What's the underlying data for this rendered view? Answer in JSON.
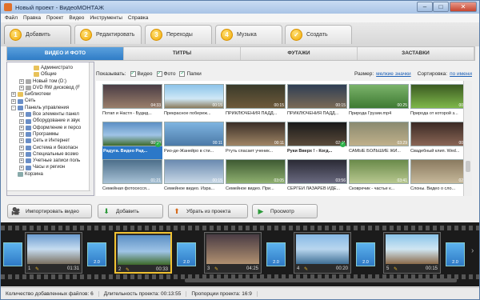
{
  "window": {
    "title": "Новый проект - ВидеоМОНТАЖ"
  },
  "menu": [
    "Файл",
    "Правка",
    "Проект",
    "Видео",
    "Инструменты",
    "Справка"
  ],
  "steps": [
    {
      "num": "1",
      "label": "Добавить",
      "active": true
    },
    {
      "num": "2",
      "label": "Редактировать"
    },
    {
      "num": "3",
      "label": "Переходы"
    },
    {
      "num": "4",
      "label": "Музыка"
    },
    {
      "num": "✓",
      "label": "Создать"
    }
  ],
  "subtabs": [
    "ВИДЕО И ФОТО",
    "ТИТРЫ",
    "ФУТАЖИ",
    "ЗАСТАВКИ"
  ],
  "tree": [
    {
      "label": "Администрато",
      "indent": 5,
      "exp": "",
      "color": "#e8c25a"
    },
    {
      "label": "Общие",
      "indent": 5,
      "exp": "",
      "color": "#e8c25a"
    },
    {
      "label": "Новый том (D:)",
      "indent": 3,
      "exp": "+",
      "color": "#aaa"
    },
    {
      "label": "DVD RW дисковод (F",
      "indent": 3,
      "exp": "+",
      "color": "#aaa"
    },
    {
      "label": "Библиотеки",
      "indent": 1,
      "exp": "+",
      "color": "#e8c25a"
    },
    {
      "label": "Сеть",
      "indent": 1,
      "exp": "+",
      "color": "#6b8fc7"
    },
    {
      "label": "Панель управления",
      "indent": 1,
      "exp": "-",
      "color": "#6b8fc7"
    },
    {
      "label": "Все элементы панел",
      "indent": 3,
      "exp": "+",
      "color": "#6b8fc7"
    },
    {
      "label": "Оборудование и звук",
      "indent": 3,
      "exp": "+",
      "color": "#6b8fc7"
    },
    {
      "label": "Оформление и персо",
      "indent": 3,
      "exp": "+",
      "color": "#6b8fc7"
    },
    {
      "label": "Программы",
      "indent": 3,
      "exp": "+",
      "color": "#6b8fc7"
    },
    {
      "label": "Сеть и Интернет",
      "indent": 3,
      "exp": "+",
      "color": "#6b8fc7"
    },
    {
      "label": "Система и безопасн",
      "indent": 3,
      "exp": "+",
      "color": "#6b8fc7"
    },
    {
      "label": "Специальные возмо",
      "indent": 3,
      "exp": "+",
      "color": "#6b8fc7"
    },
    {
      "label": "Учетные записи поль",
      "indent": 3,
      "exp": "+",
      "color": "#6b8fc7"
    },
    {
      "label": "Часы и регион",
      "indent": 3,
      "exp": "+",
      "color": "#6b8fc7"
    },
    {
      "label": "Корзина",
      "indent": 1,
      "exp": "",
      "color": "#8aa"
    }
  ],
  "filter": {
    "show_label": "Показывать:",
    "video": "Видео",
    "photo": "Фото",
    "folders": "Папки",
    "size_label": "Размер:",
    "size_value": "мелкие значки",
    "sort_label": "Сортировка:",
    "sort_value": "по имени"
  },
  "files": [
    {
      "cap": "Потап и Настя - Будид...",
      "dur": "04:33",
      "bg": "linear-gradient(#4a3c44,#9a7f6b)"
    },
    {
      "cap": "Прекрасное побереж...",
      "dur": "00:15",
      "bg": "linear-gradient(#8cc4ea,#cfe8f6 60%,#8a7a5a)"
    },
    {
      "cap": "ПРИКЛЮЧЕНИЯ ПАДД...",
      "dur": "00:15",
      "bg": "linear-gradient(#3a3a2a,#6e5a3a)"
    },
    {
      "cap": "ПРИКЛЮЧЕНИЯ ПАДД...",
      "dur": "00:15",
      "bg": "linear-gradient(#2f3e55,#7a6a55)"
    },
    {
      "cap": "Природа Грузии.mp4",
      "dur": "00:25",
      "bg": "linear-gradient(#7ab36a,#3f7a33)"
    },
    {
      "cap": "Природа от которой з...",
      "dur": "00:23",
      "bg": "linear-gradient(#3b5a22,#7fb84a)"
    },
    {
      "cap": "Радуга. Видео Рад...",
      "dur": "00:33",
      "bg": "linear-gradient(#5b8fc4,#9fc4e6 55%,#3e6a2a)",
      "sel": true,
      "ok": true
    },
    {
      "cap": "Рио-де-Жанейро в сти...",
      "dur": "00:11",
      "bg": "linear-gradient(#7eb4e0,#4c7aa8)"
    },
    {
      "cap": "Ртуть спасает ученик...",
      "dur": "00:11",
      "bg": "linear-gradient(#3a2f28,#a08565)"
    },
    {
      "cap": "Руки Вверх ! - Когд...",
      "dur": "02:41",
      "bg": "linear-gradient(#1a1a1a,#5a4a3a)",
      "ok": true,
      "bold": true
    },
    {
      "cap": "САМЫЕ БОЛЬШИЕ ЖИ...",
      "dur": "03:29",
      "bg": "linear-gradient(#8a8a70,#c0b08a)"
    },
    {
      "cap": "Свадебный клип. Wed...",
      "dur": "00:43",
      "bg": "linear-gradient(#3a2a25,#8a6555)"
    },
    {
      "cap": "Семейная фотосесся...",
      "dur": "01:21",
      "bg": "linear-gradient(#4c6e8a,#a8c2d6)"
    },
    {
      "cap": "Семейное видео. Изра...",
      "dur": "00:15",
      "bg": "linear-gradient(#6a8ab0,#c8d8e6)"
    },
    {
      "cap": "Семейное видео. При...",
      "dur": "03:05",
      "bg": "linear-gradient(#3e5a32,#8fb070)"
    },
    {
      "cap": "СЕРГЕЙ ЛАЗАРЕВ ИДЕ...",
      "dur": "03:56",
      "bg": "linear-gradient(#2a2a35,#6a6a80)"
    },
    {
      "cap": "Сковречик - частье к...",
      "dur": "03:41",
      "bg": "linear-gradient(#6a8a4a,#b8c890)"
    },
    {
      "cap": "Слоны. Видео о сло...",
      "dur": "02:12",
      "bg": "linear-gradient(#8a7a60,#c6b89a)"
    }
  ],
  "buttons": {
    "import": "Импортировать видео",
    "add": "Добавить",
    "remove": "Убрать из проекта",
    "preview": "Просмотр"
  },
  "clips": [
    {
      "num": "1",
      "time": "01:31",
      "bg": "linear-gradient(#6b9cd0,#c6dcf0 50%,#7a7060)"
    },
    {
      "num": "2",
      "time": "00:33",
      "bg": "linear-gradient(#5b8fc4,#9fc4e6 55%,#3e6a2a)",
      "sel": true
    },
    {
      "num": "3",
      "time": "04:25",
      "bg": "linear-gradient(#4a3c44,#b09070)"
    },
    {
      "num": "4",
      "time": "00:20",
      "bg": "linear-gradient(#87b9e6,#b8d6ee 50%,#3f6f95)"
    },
    {
      "num": "5",
      "time": "00:15",
      "bg": "linear-gradient(#8ac4ea,#d0e6f2 50%,#8a6a4a)"
    }
  ],
  "transition_label": "2.0",
  "status": {
    "count": "Количество добавленных файлов: 6",
    "duration": "Длительность проекта: 00:13:55",
    "ratio": "Пропорции проекта: 16:9"
  }
}
